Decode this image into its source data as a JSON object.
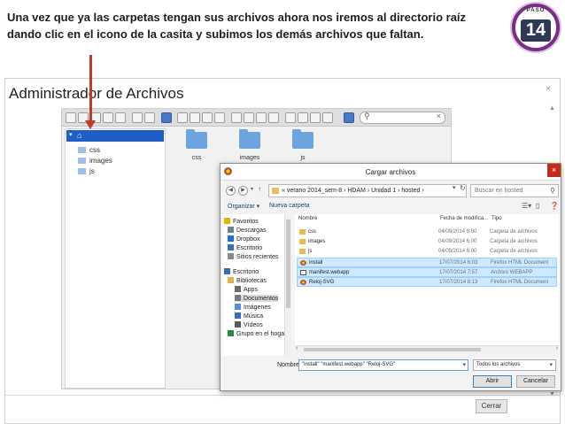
{
  "instruction": "Una vez que ya las carpetas tengan sus archivos ahora nos iremos al directorio raíz dando clic en el icono de la casita y subimos los demás archivos que faltan.",
  "badge": {
    "caption": "PASO",
    "number": "14"
  },
  "manager": {
    "title": "Administrador de Archivos",
    "close": "×",
    "tree": {
      "root_icon": "home-icon",
      "items": [
        "css",
        "images",
        "js"
      ]
    },
    "folders": [
      "css",
      "images",
      "js"
    ],
    "search_placeholder": "",
    "close_button": "Cerrar"
  },
  "dialog": {
    "title": "Cargar archivos",
    "close": "×",
    "breadcrumb": "« verano 2014_sem-8 › HDAM › Unidad 1 › hosted ›",
    "search_placeholder": "Buscar en hosted",
    "organize": "Organizar ▾",
    "new_folder": "Nueva carpeta",
    "nav": [
      {
        "label": "Favoritos",
        "icon": "star-icon",
        "color": "#e8b400"
      },
      {
        "label": "Descargas",
        "icon": "download-icon",
        "color": "#6e7f9a"
      },
      {
        "label": "Dropbox",
        "icon": "dropbox-icon",
        "color": "#1e6ed6"
      },
      {
        "label": "Escritorio",
        "icon": "desktop-icon",
        "color": "#3a6fb5"
      },
      {
        "label": "Sitios recientes",
        "icon": "recent-icon",
        "color": "#8a8a8a"
      },
      {
        "label": "Escritorio",
        "icon": "desktop-icon",
        "color": "#3a6fb5"
      },
      {
        "label": "Bibliotecas",
        "icon": "library-icon",
        "color": "#e0b24a"
      },
      {
        "label": "Apps",
        "icon": "apps-icon",
        "color": "#6a6a6a"
      },
      {
        "label": "Documentos",
        "icon": "documents-icon",
        "color": "#7a7a7a"
      },
      {
        "label": "Imágenes",
        "icon": "images-icon",
        "color": "#5b8fd1"
      },
      {
        "label": "Música",
        "icon": "music-icon",
        "color": "#3a6fb5"
      },
      {
        "label": "Vídeos",
        "icon": "videos-icon",
        "color": "#5a5a5a"
      },
      {
        "label": "Grupo en el hoga",
        "icon": "homegroup-icon",
        "color": "#2b8a3e"
      }
    ],
    "columns": [
      "Nombre",
      "Fecha de modifica...",
      "Tipo"
    ],
    "files": [
      {
        "name": "css",
        "date": "04/09/2014 6:00",
        "type": "Carpeta de archivos",
        "kind": "folder",
        "selected": false
      },
      {
        "name": "images",
        "date": "04/09/2014 6:00",
        "type": "Carpeta de archivos",
        "kind": "folder",
        "selected": false
      },
      {
        "name": "js",
        "date": "04/09/2014 6:00",
        "type": "Carpeta de archivos",
        "kind": "folder",
        "selected": false
      },
      {
        "name": "install",
        "date": "17/07/2014 6:03",
        "type": "Firefox HTML Document",
        "kind": "ff",
        "selected": true
      },
      {
        "name": "manifest.webapp",
        "date": "17/07/2014 7:57",
        "type": "Archivo WEBAPP",
        "kind": "doc",
        "selected": true
      },
      {
        "name": "Reloj-SVG",
        "date": "17/07/2014 8:13",
        "type": "Firefox HTML Document",
        "kind": "ff",
        "selected": true
      }
    ],
    "filename_label": "Nombre:",
    "filename_value": "\"install\" \"manifest.webapp\" \"Reloj-SVG\"",
    "filetype": "Todos los archivos",
    "open": "Abrir",
    "cancel": "Cancelar"
  },
  "colors": {
    "accent": "#1f5dc7",
    "badge_ring": "#7a2d86",
    "arrow": "#c0392b"
  }
}
